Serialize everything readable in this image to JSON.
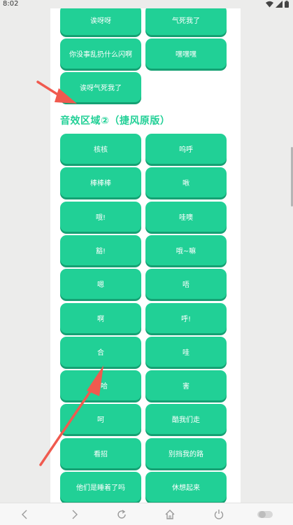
{
  "status_bar": {
    "time": "8:02"
  },
  "top_rows": [
    [
      "诶呀呀",
      "气死我了"
    ],
    [
      "你没事乱扔什么闪啊",
      "嘿嘿嘿"
    ],
    [
      "诶呀气死我了"
    ]
  ],
  "section_title": "音效区域②（捷风原版）",
  "section_rows": [
    [
      "核核",
      "呜呼"
    ],
    [
      "棒棒棒",
      "啾"
    ],
    [
      "哦!",
      "哇噢"
    ],
    [
      "豁!",
      "哦~嘛"
    ],
    [
      "嗯",
      "唔"
    ],
    [
      "啊",
      "呼!"
    ],
    [
      "合",
      "哇"
    ],
    [
      "哈哈",
      "害"
    ],
    [
      "呵",
      "酷我们走"
    ],
    [
      "看招",
      "别挡我的路"
    ],
    [
      "他们是睡着了吗",
      "休想起来"
    ]
  ],
  "colors": {
    "accent": "#21d096",
    "accent_shadow": "#15a173",
    "arrow": "#f05a4f"
  },
  "icons": [
    "wifi-icon",
    "signal-icon",
    "battery-icon",
    "back-icon",
    "forward-icon",
    "refresh-icon",
    "home-icon",
    "power-icon",
    "toggle-icon"
  ]
}
